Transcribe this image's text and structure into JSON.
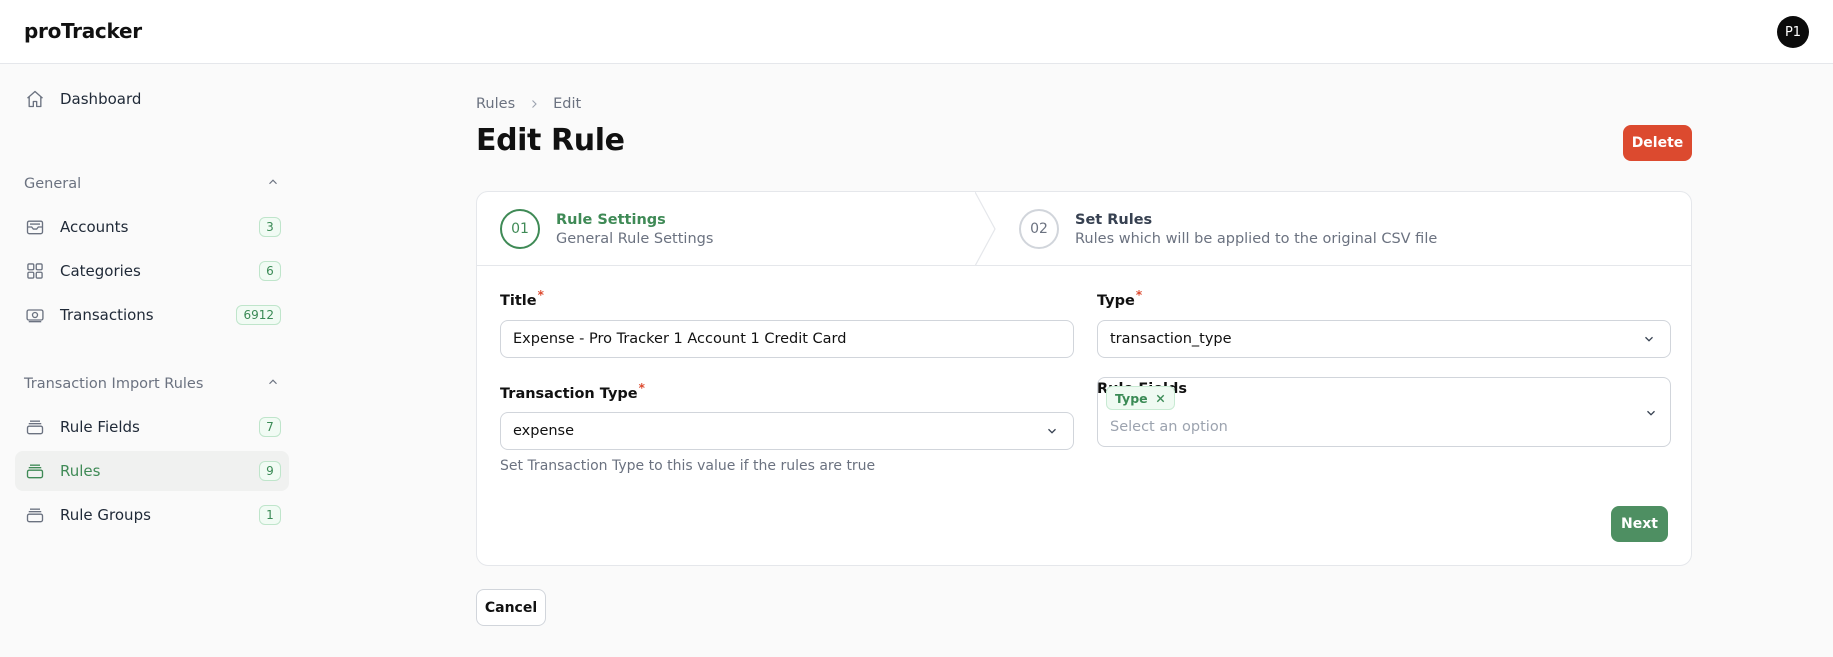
{
  "app": {
    "brand": "proTracker",
    "avatar_initials": "P1"
  },
  "sidebar": {
    "dashboard": {
      "label": "Dashboard",
      "icon": "home-icon"
    },
    "groups": [
      {
        "label": "General",
        "items": [
          {
            "label": "Accounts",
            "badge": "3",
            "icon": "inbox-icon"
          },
          {
            "label": "Categories",
            "badge": "6",
            "icon": "grid-icon"
          },
          {
            "label": "Transactions",
            "badge": "6912",
            "icon": "banknote-icon"
          }
        ]
      },
      {
        "label": "Transaction Import Rules",
        "items": [
          {
            "label": "Rule Fields",
            "badge": "7",
            "icon": "stack-icon"
          },
          {
            "label": "Rules",
            "badge": "9",
            "icon": "stack-icon",
            "active": true
          },
          {
            "label": "Rule Groups",
            "badge": "1",
            "icon": "stack-icon"
          }
        ]
      }
    ]
  },
  "breadcrumb": {
    "parent": "Rules",
    "current": "Edit"
  },
  "page": {
    "title": "Edit Rule",
    "delete_label": "Delete"
  },
  "steps": [
    {
      "number": "01",
      "title": "Rule Settings",
      "subtitle": "General Rule Settings"
    },
    {
      "number": "02",
      "title": "Set Rules",
      "subtitle": "Rules which will be applied to the original CSV file"
    }
  ],
  "form": {
    "title": {
      "label": "Title",
      "required_mark": "*",
      "value": "Expense - Pro Tracker 1 Account 1 Credit Card"
    },
    "type": {
      "label": "Type",
      "required_mark": "*",
      "value": "transaction_type"
    },
    "transaction_type": {
      "label": "Transaction Type",
      "required_mark": "*",
      "value": "expense",
      "help": "Set Transaction Type to this value if the rules are true"
    },
    "rule_fields": {
      "label": "Rule Fields",
      "chip": "Type",
      "placeholder": "Select an option"
    },
    "next_label": "Next"
  },
  "cancel_label": "Cancel",
  "colors": {
    "accent": "#3f8a56",
    "danger": "#dc4a2f",
    "next_button": "#4e8f62"
  }
}
